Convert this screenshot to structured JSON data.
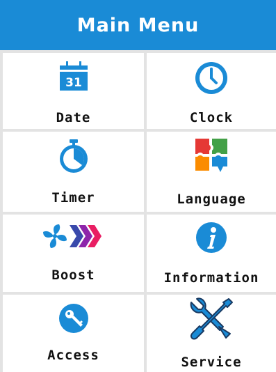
{
  "header": {
    "title": "Main Menu"
  },
  "calendar_day": "31",
  "colors": {
    "header_bg": "#1a8bd6",
    "icon_blue": "#1a8bd6",
    "divider": "#e3e3e3"
  },
  "menu": [
    {
      "id": "date",
      "label": "Date",
      "icon": "calendar-icon"
    },
    {
      "id": "clock",
      "label": "Clock",
      "icon": "clock-icon"
    },
    {
      "id": "timer",
      "label": "Timer",
      "icon": "stopwatch-icon"
    },
    {
      "id": "language",
      "label": "Language",
      "icon": "puzzle-icon"
    },
    {
      "id": "boost",
      "label": "Boost",
      "icon": "fan-boost-icon"
    },
    {
      "id": "information",
      "label": "Information",
      "icon": "info-icon"
    },
    {
      "id": "access",
      "label": "Access",
      "icon": "key-icon"
    },
    {
      "id": "service",
      "label": "Service",
      "icon": "tools-icon"
    }
  ]
}
